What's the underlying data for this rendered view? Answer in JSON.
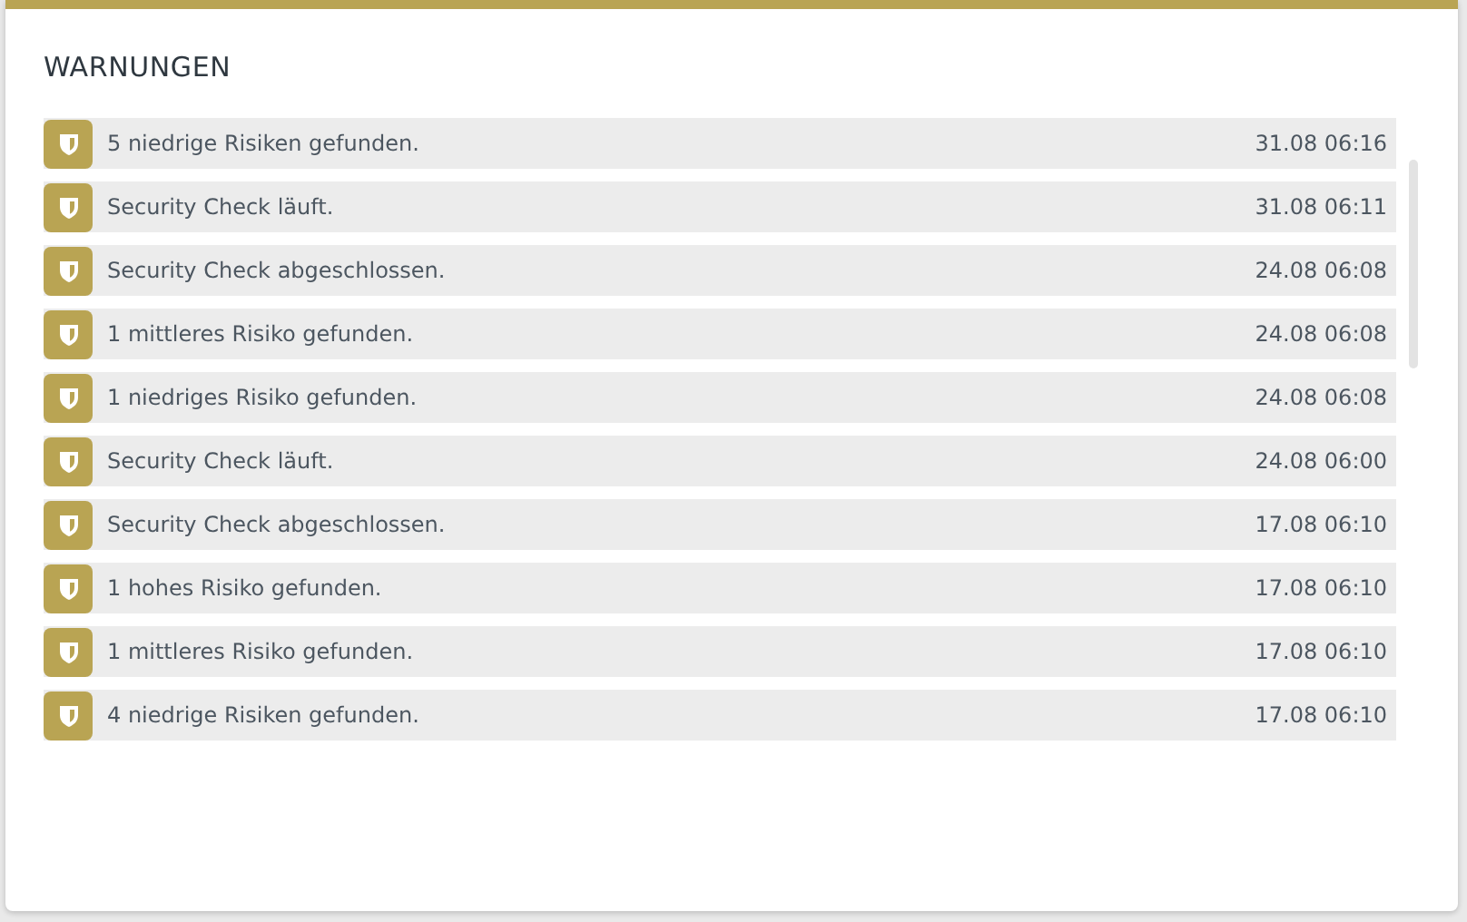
{
  "panel": {
    "title": "WARNUNGEN"
  },
  "warnings": [
    {
      "message": "5 niedrige Risiken gefunden.",
      "time": "31.08 06:16"
    },
    {
      "message": "Security Check läuft.",
      "time": "31.08 06:11"
    },
    {
      "message": "Security Check abgeschlossen.",
      "time": "24.08 06:08"
    },
    {
      "message": "1 mittleres Risiko gefunden.",
      "time": "24.08 06:08"
    },
    {
      "message": "1 niedriges Risiko gefunden.",
      "time": "24.08 06:08"
    },
    {
      "message": "Security Check läuft.",
      "time": "24.08 06:00"
    },
    {
      "message": "Security Check abgeschlossen.",
      "time": "17.08 06:10"
    },
    {
      "message": "1 hohes Risiko gefunden.",
      "time": "17.08 06:10"
    },
    {
      "message": "1 mittleres Risiko gefunden.",
      "time": "17.08 06:10"
    },
    {
      "message": "4 niedrige Risiken gefunden.",
      "time": "17.08 06:10"
    }
  ]
}
